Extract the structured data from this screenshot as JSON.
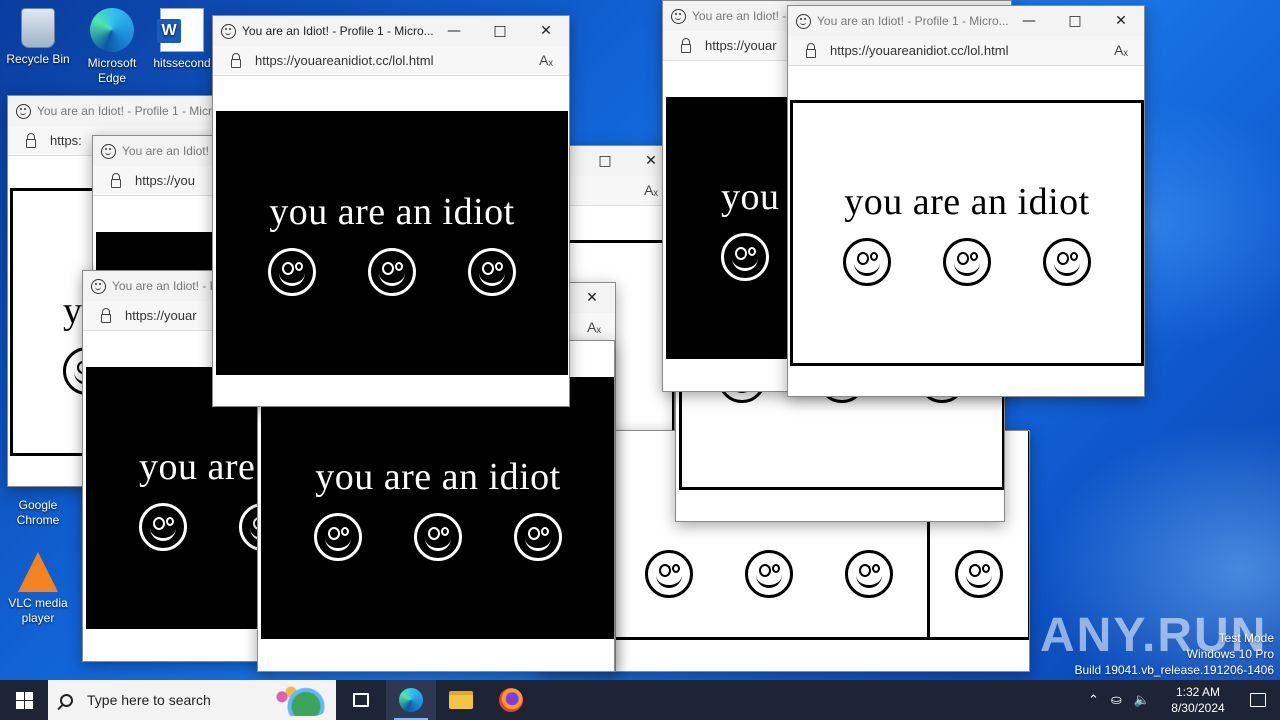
{
  "desktop": {
    "icons": [
      {
        "label": "Recycle Bin"
      },
      {
        "label": "Microsoft Edge"
      },
      {
        "label": "hitssecond"
      },
      {
        "label": "Google Chrome"
      },
      {
        "label": "VLC media player"
      }
    ]
  },
  "browser": {
    "title_full": "You are an Idiot! - Profile 1 - Microsoft Edge",
    "title_trunc": "You are an Idiot! - Profile 1 - Micro...",
    "title_short": "You are an Idiot! - P",
    "title_mid": "You are an Idiot! - Profile 1 - Micro",
    "title_tiny": "You are an Idiot! -",
    "url": "https://youareanidiot.cc/lol.html",
    "url_short": "https://youar",
    "url_shorter": "https://you",
    "url_tiny": "https:",
    "read_aloud": "Aₓ",
    "page_text": "you are an idiot",
    "page_text_short": "you are",
    "page_text_tiny": "you",
    "page_text_y": "y",
    "page_text_t": "t"
  },
  "controls": {
    "minimize": "—",
    "maximize": "□",
    "close": "✕"
  },
  "taskbar": {
    "search_placeholder": "Type here to search",
    "time": "1:32 AM",
    "date": "8/30/2024",
    "tray_up": "⌃",
    "tray_net": "⛀",
    "tray_vol": "🔈"
  },
  "watermark": {
    "line1": "Test Mode",
    "line2": "Windows 10 Pro",
    "line3": "Build 19041.vb_release.191206-1406",
    "brand": "ANY.RUN"
  },
  "colors": {
    "accent": "#0078d7",
    "taskbar": "#1c2436",
    "desktop": "#1163d6"
  }
}
